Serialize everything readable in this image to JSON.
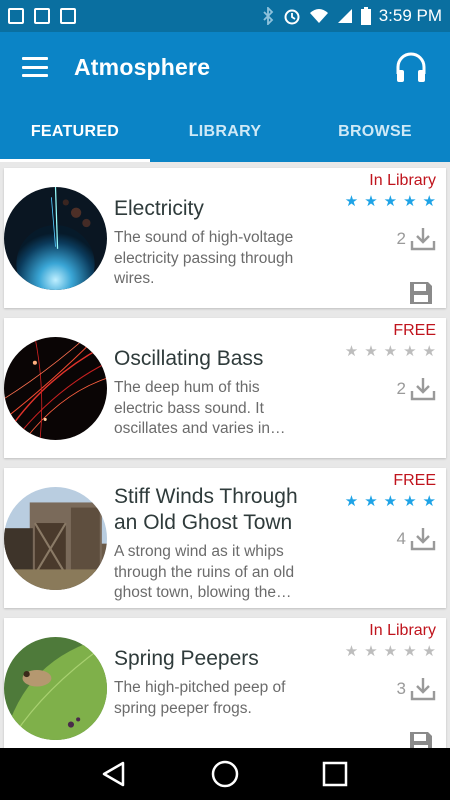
{
  "status": {
    "time": "3:59 PM"
  },
  "app": {
    "title": "Atmosphere"
  },
  "tabs": [
    {
      "label": "FEATURED",
      "active": true
    },
    {
      "label": "LIBRARY",
      "active": false
    },
    {
      "label": "BROWSE",
      "active": false
    }
  ],
  "items": [
    {
      "name": "Electricity",
      "name_lines": [
        "Electricity"
      ],
      "desc_lines": [
        "The sound of high-voltage",
        "electricity passing through",
        "wires."
      ],
      "badge": "In Library",
      "rating": 5,
      "downloads": "2",
      "in_library": true,
      "thumb": "electricity"
    },
    {
      "name": "Oscillating Bass",
      "name_lines": [
        "Oscillating Bass"
      ],
      "desc_lines": [
        "The deep hum of this",
        "electric bass sound. It",
        "oscillates and varies in…"
      ],
      "badge": "FREE",
      "rating": 0,
      "downloads": "2",
      "in_library": false,
      "thumb": "bass"
    },
    {
      "name": "Stiff Winds Through an Old Ghost Town",
      "name_lines": [
        "Stiff Winds Through",
        "an Old Ghost Town"
      ],
      "desc_lines": [
        "A strong wind as it whips",
        "through the ruins of an old",
        "ghost town, blowing the…"
      ],
      "badge": "FREE",
      "rating": 5,
      "downloads": "4",
      "in_library": false,
      "thumb": "ghosttown"
    },
    {
      "name": "Spring Peepers",
      "name_lines": [
        "Spring Peepers"
      ],
      "desc_lines": [
        "The high-pitched peep of",
        "spring peeper frogs."
      ],
      "badge": "In Library",
      "rating": 0,
      "downloads": "3",
      "in_library": true,
      "thumb": "peepers"
    }
  ],
  "colors": {
    "appbar": "#0b84c6",
    "statusbar": "#0a6fa0",
    "star_on": "#1ea3e6",
    "star_off": "#bdbdbd",
    "badge": "#c0141d"
  }
}
